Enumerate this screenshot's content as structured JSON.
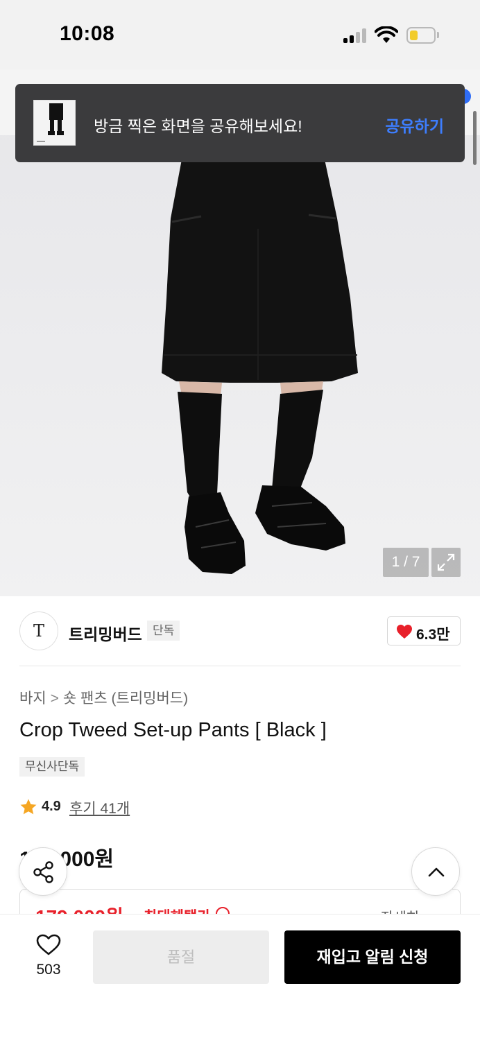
{
  "status_bar": {
    "time": "10:08"
  },
  "toast": {
    "message": "방금 찍은 화면을 공유해보세요!",
    "action": "공유하기"
  },
  "gallery": {
    "counter": "1 / 7"
  },
  "brand": {
    "logo_text": "T",
    "name": "트리밍버드",
    "tag": "단독",
    "likes": "6.3만"
  },
  "breadcrumb": {
    "level1": "바지",
    "separator": ">",
    "level2": "숏 팬츠 (트리밍버드)"
  },
  "product": {
    "title": "Crop Tweed Set-up Pants [ Black ]",
    "badge": "무신사단독",
    "rating": "4.9",
    "reviews": "후기 41개",
    "price": "179,000원"
  },
  "benefit": {
    "price": "179,000원",
    "label": "최대혜택가",
    "detail": "자세히 >"
  },
  "bottom_bar": {
    "wish_count": "503",
    "soldout_label": "품절",
    "restock_label": "재입고 알림 신청"
  },
  "colors": {
    "accent_blue": "#3d7eff",
    "sale_red": "#e8202a",
    "heart_red": "#e8202a"
  }
}
